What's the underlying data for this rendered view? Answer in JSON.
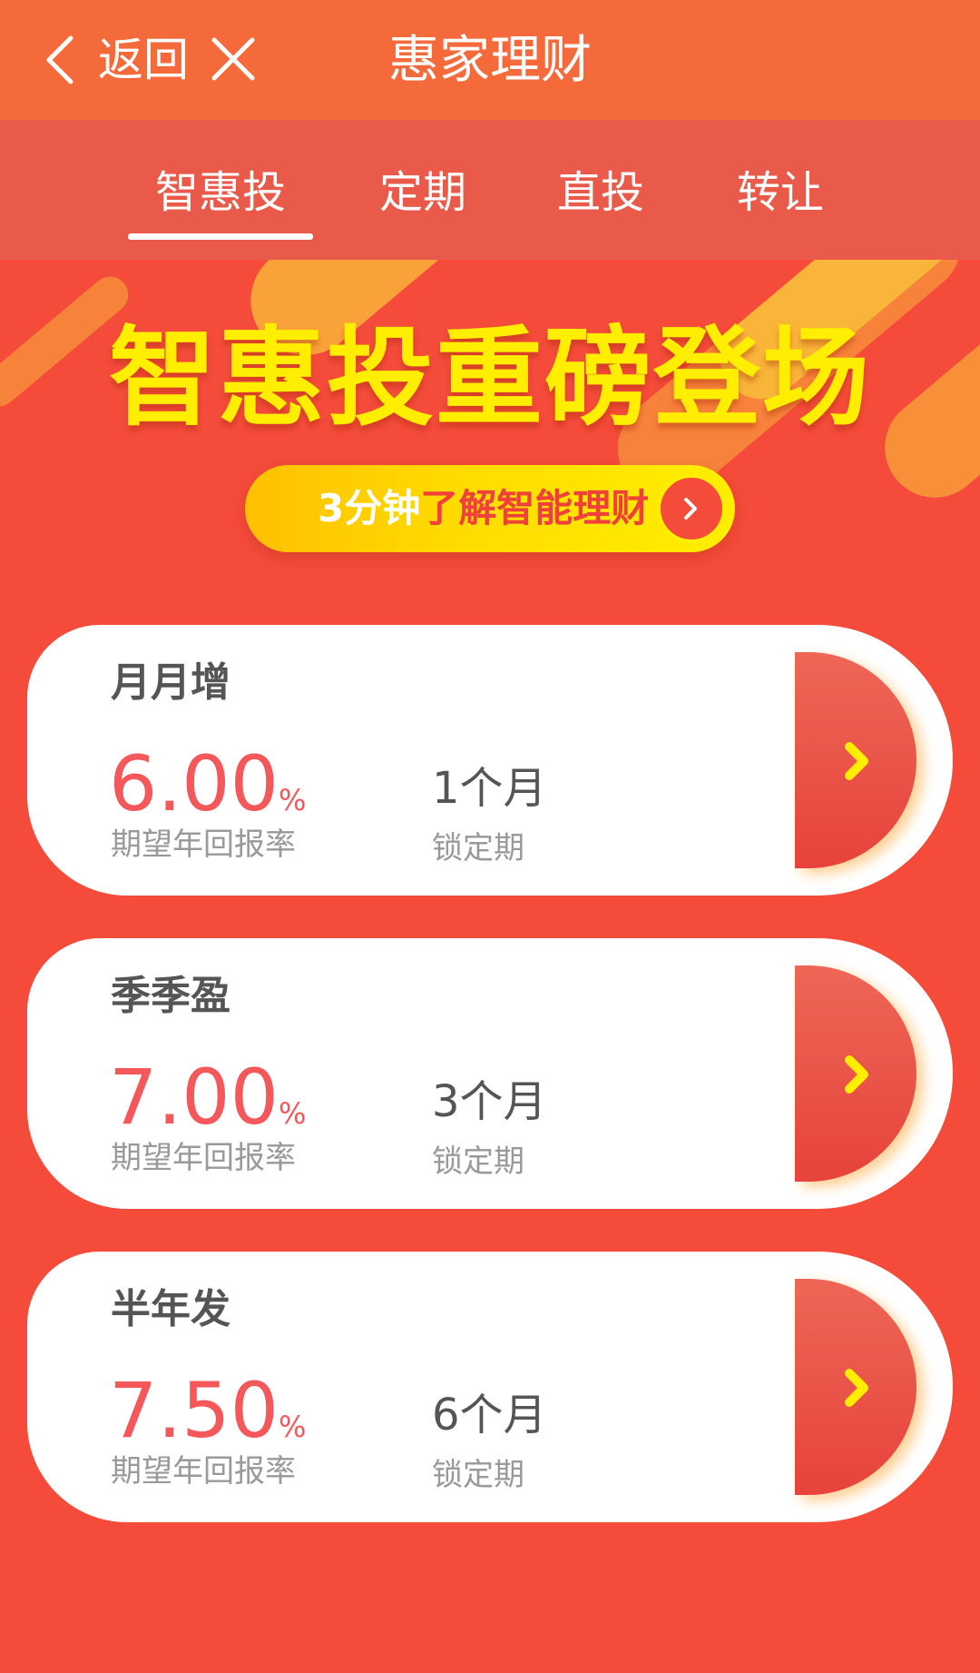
{
  "header": {
    "back_label": "返回",
    "title": "惠家理财"
  },
  "tabs": [
    {
      "label": "智惠投",
      "active": true
    },
    {
      "label": "定期",
      "active": false
    },
    {
      "label": "直投",
      "active": false
    },
    {
      "label": "转让",
      "active": false
    }
  ],
  "banner": {
    "headline": "智惠投重磅登场",
    "pill_prefix": "3分钟",
    "pill_highlight": "了解智能理财"
  },
  "products": [
    {
      "name": "月月增",
      "rate": "6.00",
      "rate_unit": "%",
      "rate_label": "期望年回报率",
      "term": "1个月",
      "term_label": "锁定期"
    },
    {
      "name": "季季盈",
      "rate": "7.00",
      "rate_unit": "%",
      "rate_label": "期望年回报率",
      "term": "3个月",
      "term_label": "锁定期"
    },
    {
      "name": "半年发",
      "rate": "7.50",
      "rate_unit": "%",
      "rate_label": "期望年回报率",
      "term": "6个月",
      "term_label": "锁定期"
    }
  ],
  "colors": {
    "header_bg": "#F46A3A",
    "tabs_bg": "#E95A4A",
    "page_bg": "#F44B3A",
    "rate_red": "#F4585A",
    "banner_yellow": "#FFEE00"
  },
  "icons": {
    "back": "chevron-left-icon",
    "close": "close-icon",
    "go": "chevron-right-icon"
  }
}
